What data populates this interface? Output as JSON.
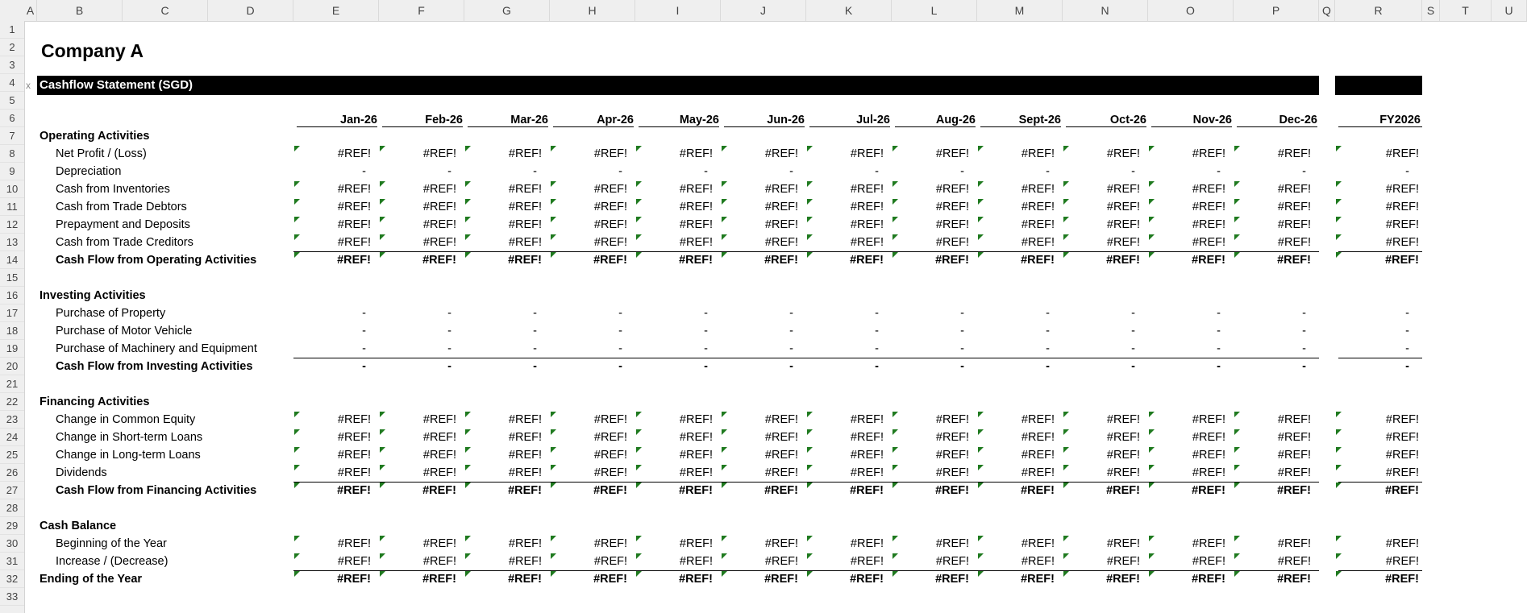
{
  "column_headers": [
    "A",
    "B",
    "C",
    "D",
    "E",
    "F",
    "G",
    "H",
    "I",
    "J",
    "K",
    "L",
    "M",
    "N",
    "O",
    "P",
    "Q",
    "R",
    "S",
    "T",
    "U"
  ],
  "row_numbers": [
    "1",
    "2",
    "3",
    "4",
    "5",
    "6",
    "7",
    "8",
    "9",
    "10",
    "11",
    "12",
    "13",
    "14",
    "15",
    "16",
    "17",
    "18",
    "19",
    "20",
    "21",
    "22",
    "23",
    "24",
    "25",
    "26",
    "27",
    "28",
    "29",
    "30",
    "31",
    "32",
    "33"
  ],
  "company": "Company A",
  "statement_title": "Cashflow Statement (SGD)",
  "row4_marker": "x",
  "months": [
    "Jan-26",
    "Feb-26",
    "Mar-26",
    "Apr-26",
    "May-26",
    "Jun-26",
    "Jul-26",
    "Aug-26",
    "Sept-26",
    "Oct-26",
    "Nov-26",
    "Dec-26"
  ],
  "fy_label": "FY2026",
  "rows": [
    {
      "row": 7,
      "label": "Operating Activities",
      "type": "section"
    },
    {
      "row": 8,
      "label": "Net Profit / (Loss)",
      "type": "item",
      "value": "#REF!"
    },
    {
      "row": 9,
      "label": "Depreciation",
      "type": "item",
      "value": "-"
    },
    {
      "row": 10,
      "label": "Cash from Inventories",
      "type": "item",
      "value": "#REF!"
    },
    {
      "row": 11,
      "label": "Cash from Trade Debtors",
      "type": "item",
      "value": "#REF!"
    },
    {
      "row": 12,
      "label": "Prepayment and Deposits",
      "type": "item",
      "value": "#REF!"
    },
    {
      "row": 13,
      "label": "Cash from Trade Creditors",
      "type": "item",
      "value": "#REF!"
    },
    {
      "row": 14,
      "label": "Cash Flow from Operating Activities",
      "type": "total",
      "value": "#REF!"
    },
    {
      "row": 16,
      "label": "Investing Activities",
      "type": "section"
    },
    {
      "row": 17,
      "label": "Purchase of Property",
      "type": "item",
      "value": "-"
    },
    {
      "row": 18,
      "label": "Purchase of Motor Vehicle",
      "type": "item",
      "value": "-"
    },
    {
      "row": 19,
      "label": "Purchase of Machinery and Equipment",
      "type": "item",
      "value": "-"
    },
    {
      "row": 20,
      "label": "Cash Flow from Investing Activities",
      "type": "total",
      "value": "-"
    },
    {
      "row": 22,
      "label": "Financing Activities",
      "type": "section"
    },
    {
      "row": 23,
      "label": "Change in Common Equity",
      "type": "item",
      "value": "#REF!"
    },
    {
      "row": 24,
      "label": "Change in Short-term Loans",
      "type": "item",
      "value": "#REF!"
    },
    {
      "row": 25,
      "label": "Change in Long-term Loans",
      "type": "item",
      "value": "#REF!"
    },
    {
      "row": 26,
      "label": "Dividends",
      "type": "item",
      "value": "#REF!"
    },
    {
      "row": 27,
      "label": "Cash Flow from Financing Activities",
      "type": "total",
      "value": "#REF!"
    },
    {
      "row": 29,
      "label": "Cash Balance",
      "type": "section"
    },
    {
      "row": 30,
      "label": "Beginning of the Year",
      "type": "item",
      "value": "#REF!"
    },
    {
      "row": 31,
      "label": "Increase / (Decrease)",
      "type": "item",
      "value": "#REF!"
    },
    {
      "row": 32,
      "label": "Ending of the Year",
      "type": "grandtotal",
      "value": "#REF!"
    }
  ],
  "colors": {
    "header_bg": "#efefef",
    "bar": "#000000",
    "error_indicator": "#1f7a1f"
  }
}
